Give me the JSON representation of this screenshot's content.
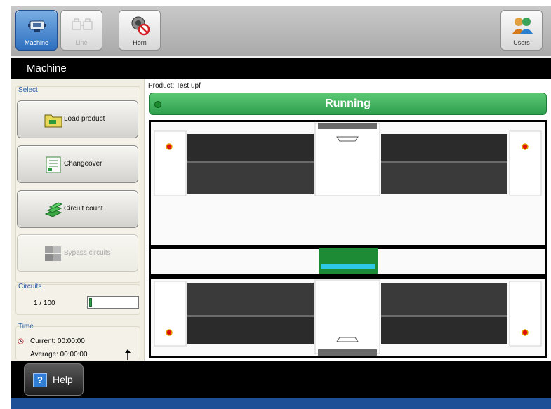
{
  "toolbar": {
    "machine_label": "Machine",
    "line_label": "Line",
    "horn_label": "Horn",
    "users_label": "Users"
  },
  "titlebar": {
    "title": "Machine"
  },
  "left": {
    "select_label": "Select",
    "buttons": {
      "load_product": "Load product",
      "changeover": "Changeover",
      "circuit_count": "Circuit count",
      "bypass_circuits": "Bypass circuits"
    },
    "circuits": {
      "label": "Circuits",
      "value": "1 / 100",
      "progress_fraction": 0.01
    },
    "time": {
      "label": "Time",
      "current": "Current: 00:00:00",
      "average": "Average: 00:00:00"
    }
  },
  "main": {
    "product": "Product: Test.upf",
    "status": "Running"
  },
  "bottom": {
    "help_label": "Help"
  },
  "colors": {
    "status_green": "#2e9e4d",
    "active_blue": "#2d6fbf",
    "footer_blue": "#1d4f96",
    "indicator_red": "#e01010"
  }
}
